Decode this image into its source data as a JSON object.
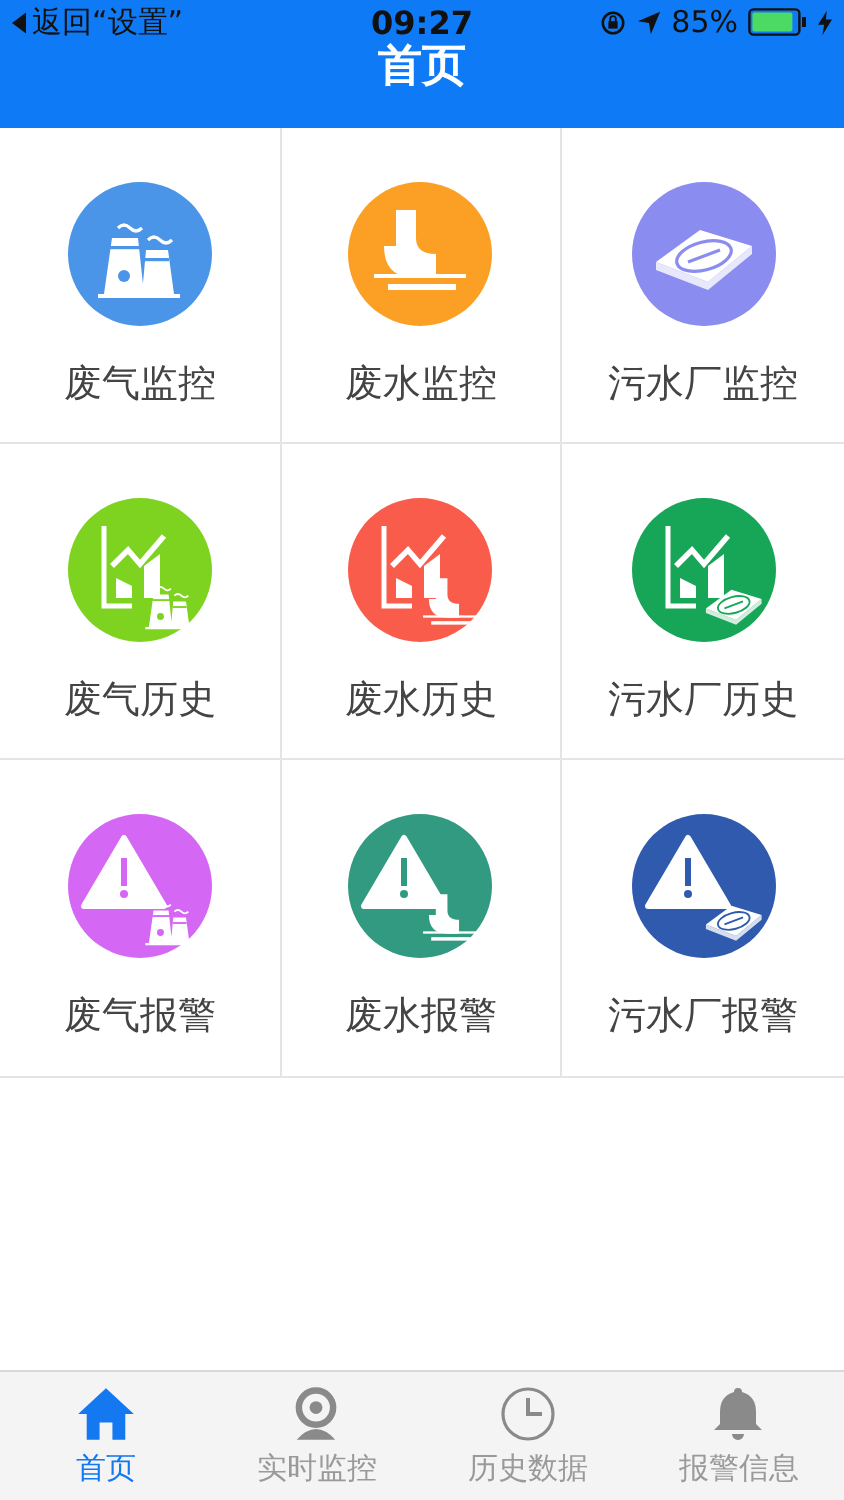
{
  "status_bar": {
    "back": "返回“设置”",
    "time": "09:27",
    "battery": "85%"
  },
  "nav_bar": {
    "title": "首页"
  },
  "tiles": [
    {
      "label": "废气监控",
      "kind": "monitor",
      "color": "#4a95e8"
    },
    {
      "label": "废水监控",
      "kind": "monitor",
      "color": "#fb9f25"
    },
    {
      "label": "污水厂监控",
      "kind": "monitor",
      "color": "#8a8cf0"
    },
    {
      "label": "废气历史",
      "kind": "history",
      "color": "#7ed321"
    },
    {
      "label": "废水历史",
      "kind": "history",
      "color": "#f95c4b"
    },
    {
      "label": "污水厂历史",
      "kind": "history",
      "color": "#17a557"
    },
    {
      "label": "废气报警",
      "kind": "alarm",
      "color": "#d567f5"
    },
    {
      "label": "废水报警",
      "kind": "alarm",
      "color": "#329a80"
    },
    {
      "label": "污水厂报警",
      "kind": "alarm",
      "color": "#2f5aae"
    }
  ],
  "tab_bar": [
    {
      "label": "首页",
      "selected": true
    },
    {
      "label": "实时监控",
      "selected": false
    },
    {
      "label": "历史数据",
      "selected": false
    },
    {
      "label": "报警信息",
      "selected": false
    }
  ]
}
